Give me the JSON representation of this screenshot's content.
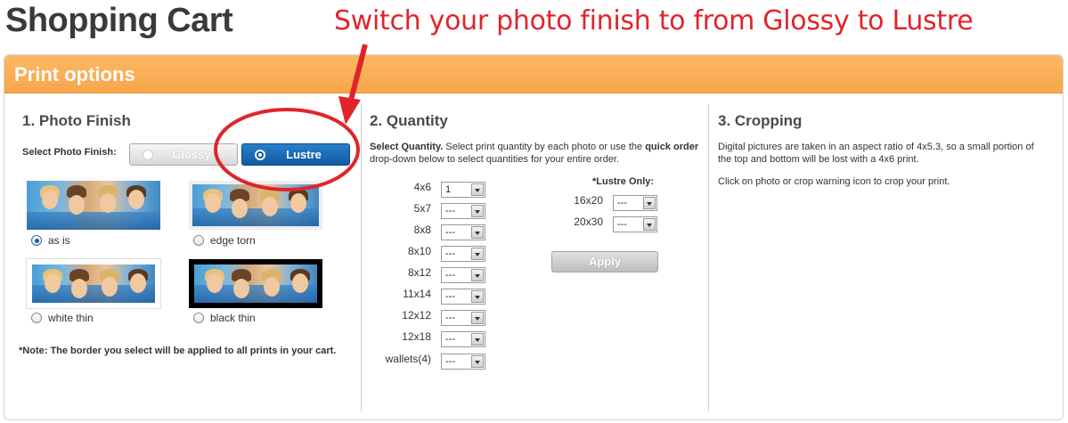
{
  "page": {
    "title": "Shopping Cart"
  },
  "annotation": {
    "text": "Switch your photo finish to from Glossy to Lustre",
    "color": "#e1242a"
  },
  "panel": {
    "title": "Print options",
    "accent": "#f7a64a"
  },
  "photo_finish": {
    "title": "1. Photo Finish",
    "select_label": "Select Photo Finish:",
    "glossy_label": "Glossy",
    "lustre_label": "Lustre",
    "selected": "Lustre",
    "borders": [
      {
        "label": "as is",
        "checked": true
      },
      {
        "label": "edge torn",
        "checked": false
      },
      {
        "label": "white thin",
        "checked": false
      },
      {
        "label": "black thin",
        "checked": false
      }
    ],
    "note": "*Note: The border you select will be applied to all prints in your cart."
  },
  "quantity": {
    "title": "2. Quantity",
    "desc_bold": "Select Quantity.",
    "desc_text": " Select print quantity by each photo or use the ",
    "desc_quick": "quick order",
    "desc_rest": " drop-down below to select quantities for your entire order.",
    "sizes": [
      {
        "size": "4x6",
        "value": "1"
      },
      {
        "size": "5x7",
        "value": "---"
      },
      {
        "size": "8x8",
        "value": "---"
      },
      {
        "size": "8x10",
        "value": "---"
      },
      {
        "size": "8x12",
        "value": "---"
      },
      {
        "size": "11x14",
        "value": "---"
      },
      {
        "size": "12x12",
        "value": "---"
      },
      {
        "size": "12x18",
        "value": "---"
      },
      {
        "size": "wallets(4)",
        "value": "---"
      }
    ],
    "lustre_only_label": "*Lustre Only:",
    "lustre_sizes": [
      {
        "size": "16x20",
        "value": "---"
      },
      {
        "size": "20x30",
        "value": "---"
      }
    ],
    "apply_label": "Apply"
  },
  "cropping": {
    "title": "3. Cropping",
    "text1": "Digital pictures are taken in an aspect ratio of 4x5.3, so a small portion of the top and bottom will be lost with a 4x6 print.",
    "text2": "Click on photo or crop warning icon to crop your print."
  }
}
